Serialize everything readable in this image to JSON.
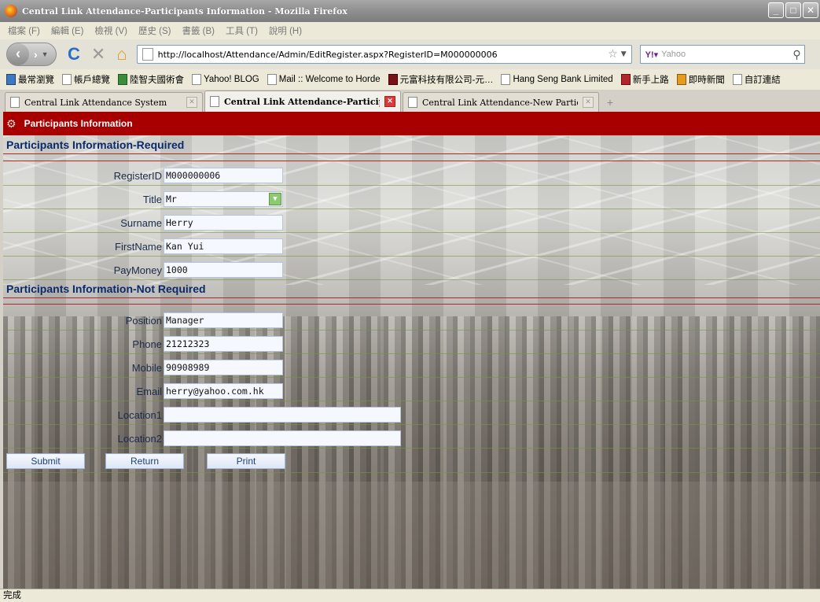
{
  "window": {
    "title": "Central Link Attendance-Participants Information - Mozilla Firefox"
  },
  "menu": [
    "檔案 (F)",
    "編輯 (E)",
    "檢視 (V)",
    "歷史 (S)",
    "書籤 (B)",
    "工具 (T)",
    "說明 (H)"
  ],
  "nav": {
    "url": "http://localhost/Attendance/Admin/EditRegister.aspx?RegisterID=M000000006",
    "search_placeholder": "Yahoo"
  },
  "bookmarks": [
    {
      "label": "最常瀏覽",
      "icon": "blue"
    },
    {
      "label": "帳戶總覽",
      "icon": "page"
    },
    {
      "label": "陸智夫國術會",
      "icon": "green"
    },
    {
      "label": "Yahoo! BLOG",
      "icon": "page"
    },
    {
      "label": "Mail :: Welcome to Horde",
      "icon": "page"
    },
    {
      "label": "元富科技有限公司-元…",
      "icon": "maroon"
    },
    {
      "label": "Hang Seng Bank Limited",
      "icon": "page"
    },
    {
      "label": "新手上路",
      "icon": "red"
    },
    {
      "label": "即時新聞",
      "icon": "orange"
    },
    {
      "label": "自訂連結",
      "icon": "page"
    }
  ],
  "tabs": [
    {
      "label": "Central Link Attendance System",
      "active": false
    },
    {
      "label": "Central Link Attendance-Particip···",
      "active": true
    },
    {
      "label": "Central Link Attendance-New Participants",
      "active": false
    }
  ],
  "page": {
    "header": "Participants Information",
    "required_title": "Participants Information-Required",
    "not_required_title": "Participants Information-Not Required",
    "fields": {
      "register_id": {
        "label": "RegisterID",
        "value": "M000000006"
      },
      "title": {
        "label": "Title",
        "value": "Mr"
      },
      "surname": {
        "label": "Surname",
        "value": "Herry"
      },
      "firstname": {
        "label": "FirstName",
        "value": "Kan Yui"
      },
      "paymoney": {
        "label": "PayMoney",
        "value": "1000"
      },
      "position": {
        "label": "Position",
        "value": "Manager"
      },
      "phone": {
        "label": "Phone",
        "value": "21212323"
      },
      "mobile": {
        "label": "Mobile",
        "value": "90908989"
      },
      "email": {
        "label": "Email",
        "value": "herry@yahoo.com.hk"
      },
      "location1": {
        "label": "Location1",
        "value": ""
      },
      "location2": {
        "label": "Location2",
        "value": ""
      }
    },
    "buttons": {
      "submit": "Submit",
      "return": "Return",
      "print": "Print"
    }
  },
  "status": "完成",
  "colors": {
    "header_red": "#a80000",
    "section_blue": "#0b2a6b"
  }
}
